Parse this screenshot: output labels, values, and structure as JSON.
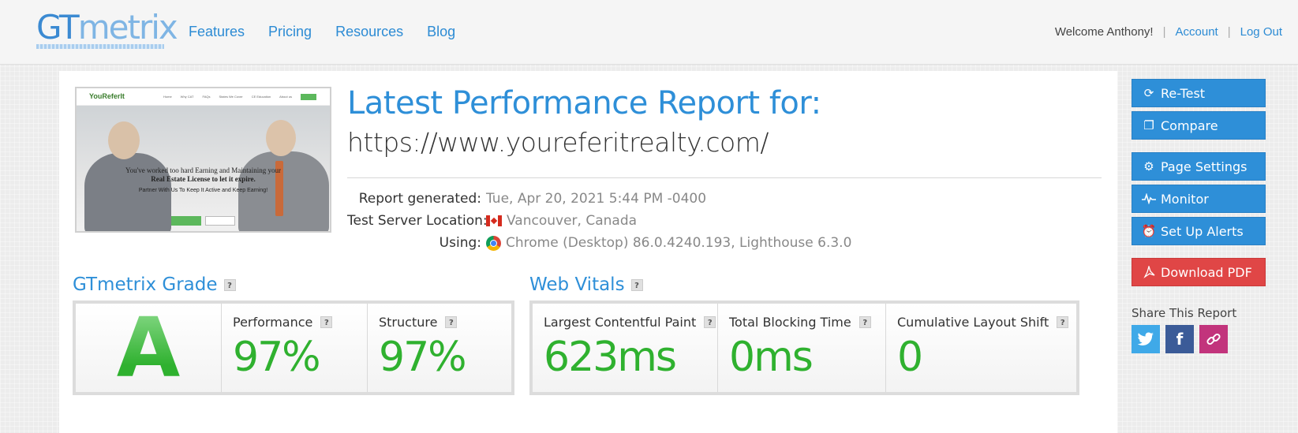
{
  "header": {
    "logo": {
      "gt": "GT",
      "metrix": "metrix"
    },
    "nav": [
      "Features",
      "Pricing",
      "Resources",
      "Blog"
    ],
    "welcome": "Welcome Anthony!",
    "account_label": "Account",
    "logout_label": "Log Out"
  },
  "thumbnail": {
    "site_logo": "YouReferIt",
    "links": [
      "Home",
      "Why CAT",
      "FAQs",
      "States We Cover",
      "CE Education",
      "About us",
      "Contact us"
    ],
    "headline_line1": "You've worked too hard Earning and Maintaining your",
    "headline_line2": "Real Estate License to let it expire.",
    "subline": "Partner With Us To Keep It Active and Keep Earning!"
  },
  "report": {
    "title": "Latest Performance Report for:",
    "url": "https://www.youreferitrealty.com/",
    "generated_label": "Report generated:",
    "generated_value": "Tue, Apr 20, 2021 5:44 PM -0400",
    "location_label": "Test Server Location:",
    "location_value": "Vancouver, Canada",
    "using_label": "Using:",
    "using_value": "Chrome (Desktop) 86.0.4240.193, Lighthouse 6.3.0"
  },
  "grade": {
    "title": "GTmetrix Grade",
    "letter": "A",
    "performance_label": "Performance",
    "performance_value": "97%",
    "structure_label": "Structure",
    "structure_value": "97%"
  },
  "vitals": {
    "title": "Web Vitals",
    "lcp_label": "Largest Contentful Paint",
    "lcp_value": "623ms",
    "tbt_label": "Total Blocking Time",
    "tbt_value": "0ms",
    "cls_label": "Cumulative Layout Shift",
    "cls_value": "0"
  },
  "help_mark": "?",
  "sidebar": {
    "retest": "Re-Test",
    "compare": "Compare",
    "page_settings": "Page Settings",
    "monitor": "Monitor",
    "alerts": "Set Up Alerts",
    "download": "Download PDF",
    "share_title": "Share This Report"
  },
  "colors": {
    "accent": "#2e8fd8",
    "grade_green": "#2fb12f",
    "pdf_red": "#e04646"
  }
}
